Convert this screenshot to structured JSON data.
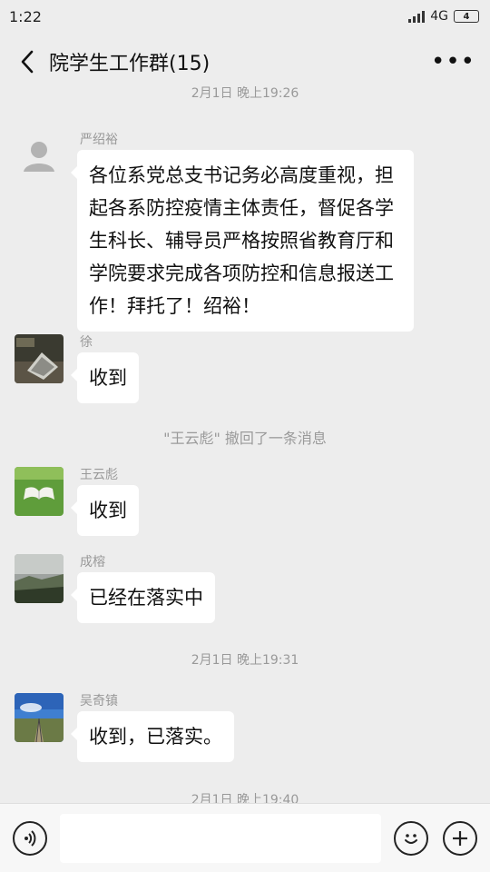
{
  "status_bar": {
    "time": "1:22",
    "network": "4G",
    "battery": "4"
  },
  "header": {
    "title": "院学生工作群(15)"
  },
  "messages": [
    {
      "type": "time",
      "text": "2月1日 晚上19:26"
    },
    {
      "type": "chat",
      "sender": "严绍裕",
      "text": "各位系党总支书记务必高度重视，担起各系防控疫情主体责任，督促各学生科长、辅导员严格按照省教育厅和学院要求完成各项防控和信息报送工作！拜托了！绍裕！"
    },
    {
      "type": "chat",
      "sender": "徐",
      "text": "收到"
    },
    {
      "type": "system",
      "text": "\"王云彪\" 撤回了一条消息"
    },
    {
      "type": "chat",
      "sender": "王云彪",
      "text": "收到"
    },
    {
      "type": "chat",
      "sender": "成榕",
      "text": "已经在落实中"
    },
    {
      "type": "time",
      "text": "2月1日 晚上19:31"
    },
    {
      "type": "chat",
      "sender": "吴奇镇",
      "text": "收到，已落实。"
    },
    {
      "type": "time",
      "text": "2月1日 晚上19:40"
    }
  ]
}
